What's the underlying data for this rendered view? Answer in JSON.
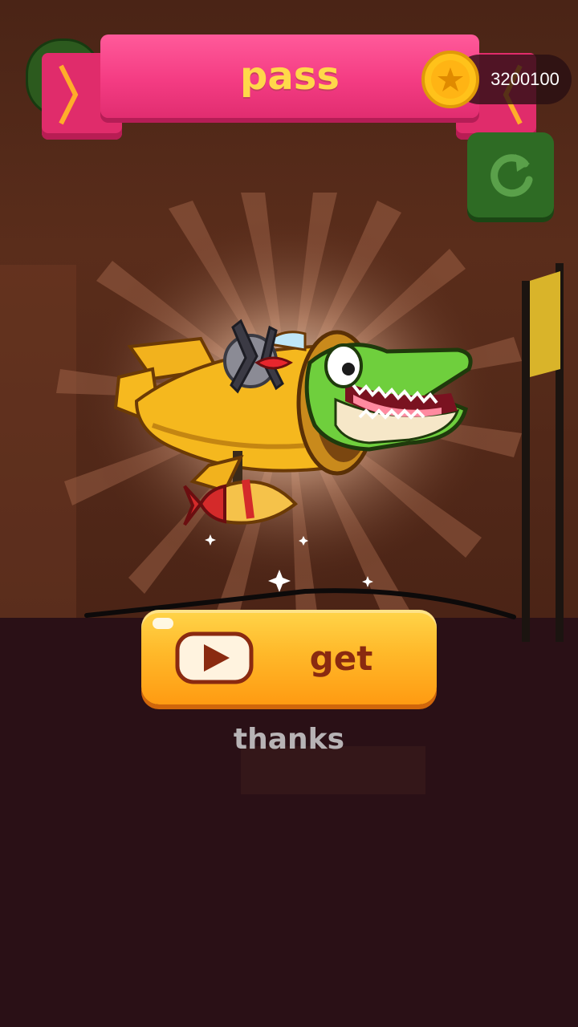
{
  "banner": {
    "title": "pass"
  },
  "coins": {
    "count": "3200100",
    "icon": "coin-star-icon"
  },
  "restart": {
    "icon": "restart-icon"
  },
  "reward": {
    "icon": "crocodile-plane-icon"
  },
  "get_button": {
    "label": "get",
    "icon": "video-play-icon"
  },
  "thanks_link": {
    "label": "thanks"
  },
  "colors": {
    "banner_pink": "#f43c83",
    "banner_text": "#ffd84a",
    "button_orange": "#ffb92a",
    "button_text": "#8a2a10",
    "restart_green": "#2e6b24"
  }
}
